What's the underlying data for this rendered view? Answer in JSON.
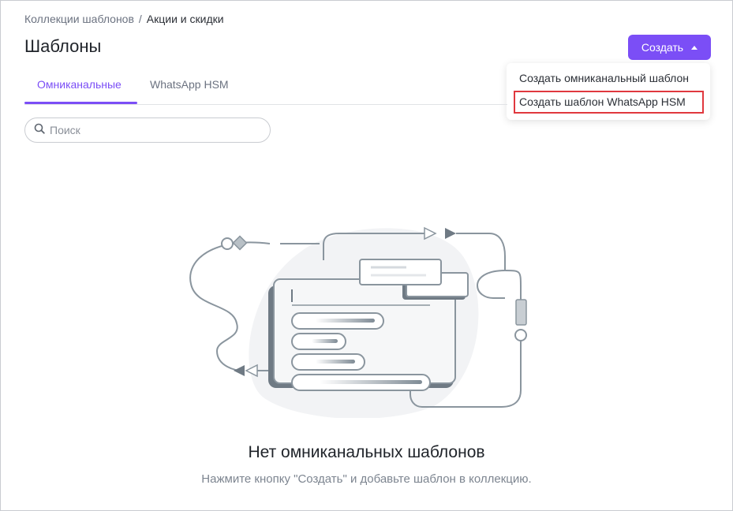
{
  "breadcrumb": {
    "parent": "Коллекции шаблонов",
    "separator": "/",
    "current": "Акции и скидки"
  },
  "page": {
    "title": "Шаблоны"
  },
  "create_button": {
    "label": "Создать"
  },
  "dropdown": {
    "items": [
      {
        "label": "Создать омниканальный шаблон"
      },
      {
        "label": "Создать шаблон WhatsApp HSM"
      }
    ]
  },
  "tabs": [
    {
      "label": "Омниканальные",
      "active": true
    },
    {
      "label": "WhatsApp HSM",
      "active": false
    }
  ],
  "search": {
    "placeholder": "Поиск",
    "value": ""
  },
  "empty_state": {
    "title": "Нет омниканальных шаблонов",
    "subtitle": "Нажмите кнопку \"Создать\" и добавьте шаблон в коллекцию."
  },
  "colors": {
    "accent": "#7b4ef6",
    "highlight": "#e0383e"
  }
}
